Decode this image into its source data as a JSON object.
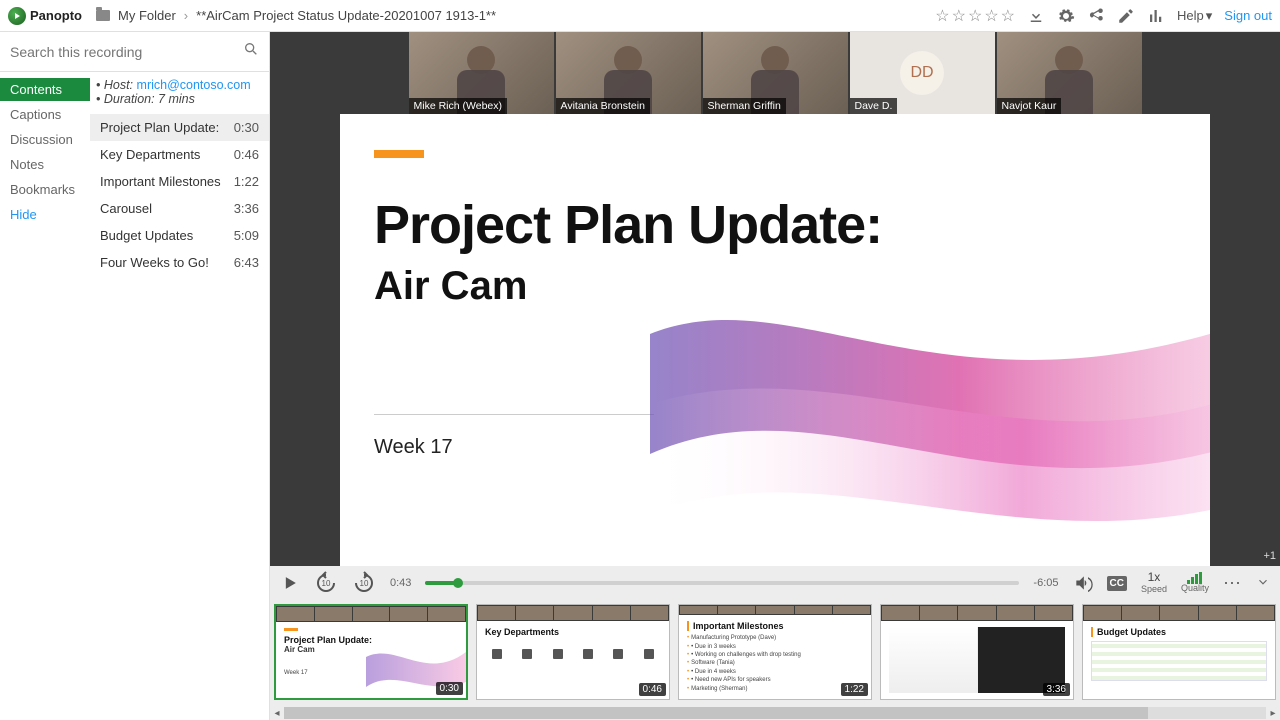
{
  "brand": "Panopto",
  "breadcrumb": {
    "folder": "My Folder",
    "title": "**AirCam Project Status Update-20201007 1913-1**"
  },
  "top": {
    "help": "Help",
    "signout": "Sign out"
  },
  "search": {
    "placeholder": "Search this recording"
  },
  "tabs": [
    "Contents",
    "Captions",
    "Discussion",
    "Notes",
    "Bookmarks",
    "Hide"
  ],
  "activeTab": 0,
  "meta": {
    "hostLabel": "Host:",
    "hostEmail": "mrich@contoso.com",
    "duration": "Duration: 7 mins"
  },
  "chapters": [
    {
      "title": "Project Plan Update:",
      "time": "0:30",
      "active": true
    },
    {
      "title": "Key Departments",
      "time": "0:46"
    },
    {
      "title": "Important Milestones",
      "time": "1:22"
    },
    {
      "title": "Carousel",
      "time": "3:36"
    },
    {
      "title": "Budget Updates",
      "time": "5:09"
    },
    {
      "title": "Four Weeks to Go!",
      "time": "6:43"
    }
  ],
  "speakers": [
    {
      "name": "Mike Rich (Webex)"
    },
    {
      "name": "Avitania Bronstein"
    },
    {
      "name": "Sherman Griffin"
    },
    {
      "name": "Dave D.",
      "initials": "DD",
      "placeholder": true
    },
    {
      "name": "Navjot Kaur"
    }
  ],
  "slide": {
    "title": "Project Plan Update:",
    "subtitle": "Air Cam",
    "week": "Week 17"
  },
  "overflow": "+1",
  "player": {
    "cur": "0:43",
    "rem": "-6:05",
    "speed": "1x",
    "speedLabel": "Speed",
    "quality": "Quality",
    "cc": "CC"
  },
  "thumbs": [
    {
      "t": "0:30",
      "title": "Project Plan Update:",
      "sub": "Air Cam",
      "kind": "title",
      "active": true
    },
    {
      "t": "0:46",
      "title": "Key Departments",
      "kind": "dept"
    },
    {
      "t": "1:22",
      "title": "Important Milestones",
      "kind": "milestones"
    },
    {
      "t": "3:36",
      "title": "",
      "kind": "carousel"
    },
    {
      "t": "",
      "title": "Budget Updates",
      "kind": "budget"
    }
  ],
  "milestones": [
    "Manufacturing Prototype (Dave)",
    "• Due in 3 weeks",
    "• Working on challenges with drop testing",
    "Software (Tania)",
    "• Due in 4 weeks",
    "• Need new APIs for speakers",
    "Marketing (Sherman)"
  ]
}
